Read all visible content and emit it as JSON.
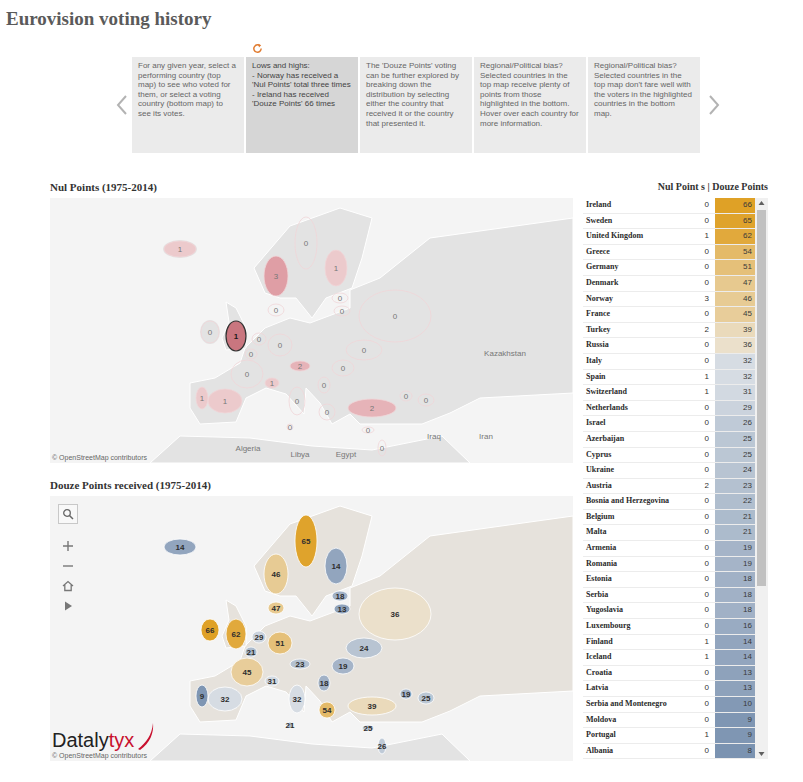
{
  "title": "Eurovision voting history",
  "carousel": {
    "cards": [
      {
        "text": "For any given year, select a performing country (top map) to see who voted for them, or select a voting country (bottom map) to see its votes.",
        "selected": false
      },
      {
        "text": "Lows and highs:\n- Norway has received a 'Nul Points' total three times\n- Ireland has received 'Douze Points' 66 times",
        "selected": true
      },
      {
        "text": "The 'Douze Points' voting can be further explored by breaking down the distribution by selecting either the country that received it or the country that presented it.",
        "selected": false
      },
      {
        "text": "Regional/Political bias? Selected countries in the top map receive plenty of points from those highlighted in the bottom.\nHover over each country for more information.",
        "selected": false
      },
      {
        "text": "Regional/Political bias? Selected countries in the top map don't fare well with the voters in the highlighted countries in the bottom map.",
        "selected": false
      }
    ]
  },
  "nulMap": {
    "title": "Nul Points (1975-2014)",
    "places": [
      "Kazakhstan",
      "Iraq",
      "Iran",
      "Algeria",
      "Libya",
      "Egypt"
    ],
    "attribution": "© OpenStreetMap contributors"
  },
  "douzeMap": {
    "title": "Douze Points received (1975-2014)",
    "attribution": "© OpenStreetMap contributors",
    "logo": {
      "main": "Dataly",
      "accent": "tyx"
    }
  },
  "table": {
    "header": "Nul Point s | Douze Points",
    "scrollbar": {
      "level": 0.7
    },
    "rows": [
      {
        "name": "Ireland",
        "nul": "0",
        "douze": "66",
        "selected": false
      },
      {
        "name": "Sweden",
        "nul": "0",
        "douze": "65",
        "selected": false
      },
      {
        "name": "United Kingdom",
        "nul": "1",
        "douze": "62",
        "selected": true
      },
      {
        "name": "Greece",
        "nul": "0",
        "douze": "54",
        "selected": false
      },
      {
        "name": "Germany",
        "nul": "0",
        "douze": "51",
        "selected": false
      },
      {
        "name": "Denmark",
        "nul": "0",
        "douze": "47",
        "selected": false
      },
      {
        "name": "Norway",
        "nul": "3",
        "douze": "46",
        "selected": false
      },
      {
        "name": "France",
        "nul": "0",
        "douze": "45",
        "selected": false
      },
      {
        "name": "Turkey",
        "nul": "2",
        "douze": "39",
        "selected": false
      },
      {
        "name": "Russia",
        "nul": "0",
        "douze": "36",
        "selected": false
      },
      {
        "name": "Italy",
        "nul": "0",
        "douze": "32",
        "selected": false
      },
      {
        "name": "Spain",
        "nul": "1",
        "douze": "32",
        "selected": false
      },
      {
        "name": "Switzerland",
        "nul": "1",
        "douze": "31",
        "selected": false
      },
      {
        "name": "Netherlands",
        "nul": "0",
        "douze": "29",
        "selected": false
      },
      {
        "name": "Israel",
        "nul": "0",
        "douze": "26",
        "selected": false
      },
      {
        "name": "Azerbaijan",
        "nul": "0",
        "douze": "25",
        "selected": false
      },
      {
        "name": "Cyprus",
        "nul": "0",
        "douze": "25",
        "selected": false
      },
      {
        "name": "Ukraine",
        "nul": "0",
        "douze": "24",
        "selected": false
      },
      {
        "name": "Austria",
        "nul": "2",
        "douze": "23",
        "selected": false
      },
      {
        "name": "Bosnia and Herzegovina",
        "nul": "0",
        "douze": "22",
        "selected": false
      },
      {
        "name": "Belgium",
        "nul": "0",
        "douze": "21",
        "selected": false
      },
      {
        "name": "Malta",
        "nul": "0",
        "douze": "21",
        "selected": false
      },
      {
        "name": "Armenia",
        "nul": "0",
        "douze": "19",
        "selected": false
      },
      {
        "name": "Romania",
        "nul": "0",
        "douze": "19",
        "selected": false
      },
      {
        "name": "Estonia",
        "nul": "0",
        "douze": "18",
        "selected": false
      },
      {
        "name": "Serbia",
        "nul": "0",
        "douze": "18",
        "selected": false
      },
      {
        "name": "Yugoslavia",
        "nul": "0",
        "douze": "18",
        "selected": false
      },
      {
        "name": "Luxembourg",
        "nul": "0",
        "douze": "16",
        "selected": false
      },
      {
        "name": "Finland",
        "nul": "1",
        "douze": "14",
        "selected": false
      },
      {
        "name": "Iceland",
        "nul": "1",
        "douze": "14",
        "selected": false
      },
      {
        "name": "Croatia",
        "nul": "0",
        "douze": "13",
        "selected": false
      },
      {
        "name": "Latvia",
        "nul": "0",
        "douze": "13",
        "selected": false
      },
      {
        "name": "Serbia and Montenegro",
        "nul": "0",
        "douze": "10",
        "selected": false
      },
      {
        "name": "Moldova",
        "nul": "0",
        "douze": "9",
        "selected": false
      },
      {
        "name": "Portugal",
        "nul": "1",
        "douze": "9",
        "selected": false
      },
      {
        "name": "Albania",
        "nul": "0",
        "douze": "8",
        "selected": false
      }
    ]
  }
}
